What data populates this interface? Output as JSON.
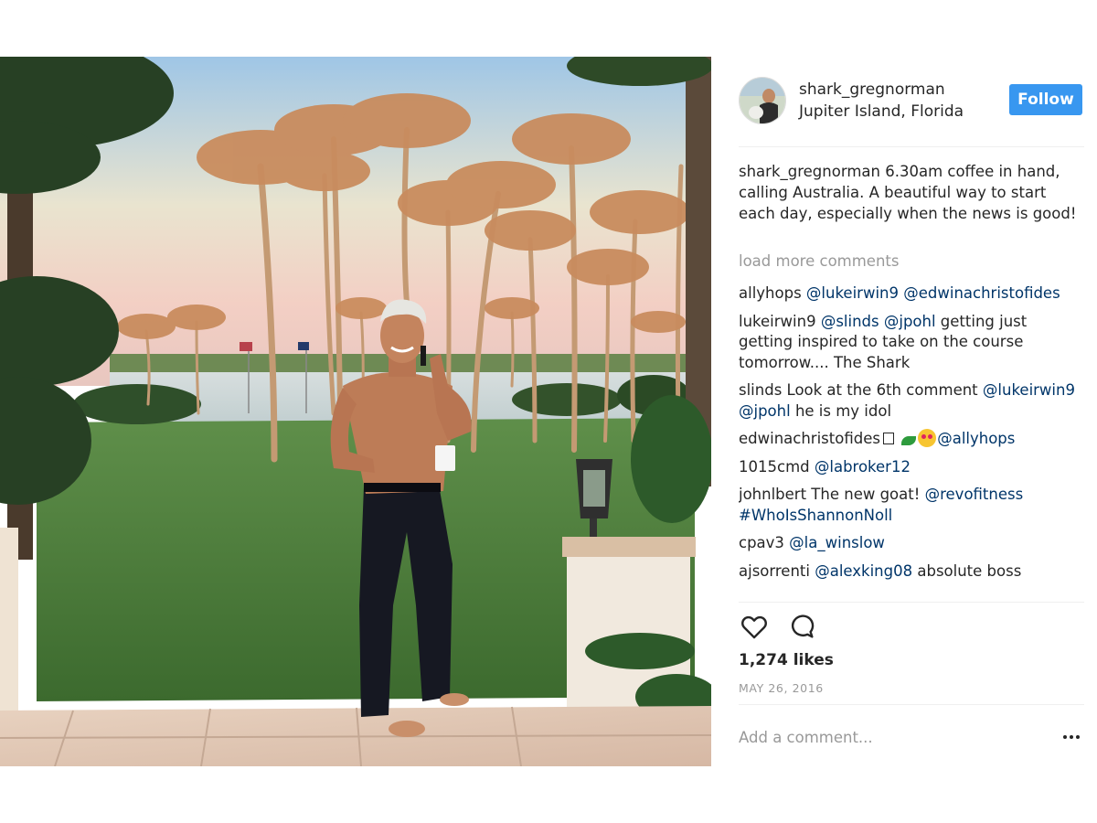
{
  "post": {
    "username": "shark_gregnorman",
    "location": "Jupiter Island, Florida",
    "follow_label": "Follow",
    "caption_user": "shark_gregnorman",
    "caption_text": " 6.30am coffee in hand, calling Australia. A beautiful way to start each day, especially when the news is good!",
    "load_more": "load more comments",
    "comments": [
      {
        "user": "allyhops",
        "mention1": "@lukeirwin9",
        "mention2": "@edwinachristofides"
      },
      {
        "user": "lukeirwin9",
        "mention1": "@slinds",
        "mention2": "@jpohl",
        "text": " getting just getting inspired to take on the course tomorrow.... The Shark"
      },
      {
        "user": "slinds",
        "text": " Look at the 6th comment",
        "mention1": "@lukeirwin9",
        "mention2": "@jpohl",
        "text2": " he is my idol"
      },
      {
        "user": "edwinachristofides",
        "mention1": "@allyhops"
      },
      {
        "user": "1015cmd",
        "mention1": "@labroker12"
      },
      {
        "user": "johnlbert",
        "text": " The new goat! ",
        "mention1": "@revofitness",
        "mention2": "#WhoIsShannonNoll"
      },
      {
        "user": "cpav3",
        "mention1": "@la_winslow"
      },
      {
        "user": "ajsorrenti",
        "mention1": "@alexking08",
        "text": " absolute boss"
      }
    ],
    "likes": "1,274 likes",
    "date": "MAY 26, 2016",
    "add_comment_placeholder": "Add a comment..."
  },
  "icons": {
    "like": "heart-icon",
    "comment": "comment-bubble-icon",
    "more": "more-options-icon"
  },
  "colors": {
    "follow_button": "#3897f0",
    "mention": "#003569",
    "muted": "#999999",
    "text": "#262626"
  }
}
